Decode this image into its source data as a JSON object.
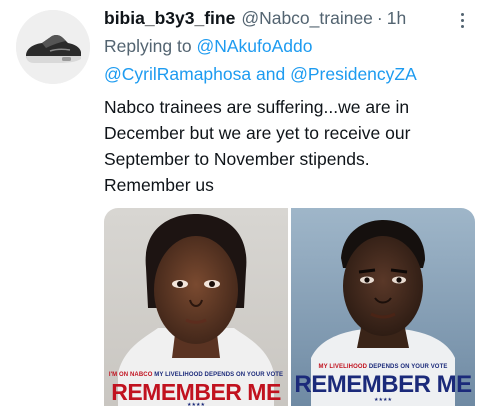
{
  "tweet": {
    "display_name": "bibia_b3y3_fine",
    "handle": "@Nabco_trainee",
    "separator": "·",
    "time": "1h",
    "replying_prefix": "Replying to",
    "mention_1": "@NAkufoAddo",
    "mention_2": "@CyrilRamaphosa",
    "and_text": "and",
    "mention_3": "@PresidencyZA",
    "text_lines": [
      "Nabco trainees are suffering...we are in",
      "December but we are yet to receive our",
      "September to November stipends.",
      "Remember us"
    ]
  },
  "media": {
    "photo_1": {
      "slogan_prefix": "I'M ON NABCO",
      "slogan_rest": "MY LIVELIHOOD DEPENDS ON YOUR VOTE",
      "title": "REMEMBER ME",
      "stars": "★★★★"
    },
    "photo_2": {
      "slogan_a": "MY LIVELIHOOD",
      "slogan_b": "DEPENDS",
      "slogan_c": "ON YOUR VOTE",
      "title": "REMEMBER ME",
      "stars": "★★★★"
    }
  },
  "colors": {
    "link": "#1d9bf0",
    "secondary_text": "#536471",
    "poster_red": "#c1121f",
    "poster_blue": "#1b2a7a"
  },
  "icons": {
    "more": "more-horizontal-icon",
    "avatar": "sneaker-avatar"
  }
}
